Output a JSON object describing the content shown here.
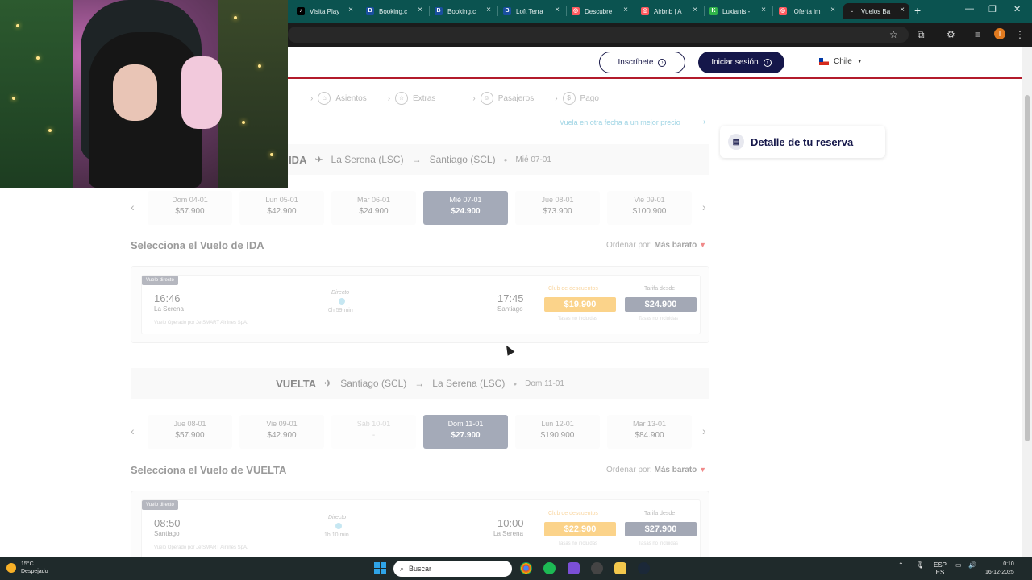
{
  "browser": {
    "tabs": [
      {
        "label": "Visita Play",
        "icon": "tiktok-icon",
        "color": "#000000",
        "glyph": "♪"
      },
      {
        "label": "Booking.c",
        "icon": "booking-icon",
        "color": "#1a4fa0",
        "glyph": "B"
      },
      {
        "label": "Booking.c",
        "icon": "booking-icon",
        "color": "#1a4fa0",
        "glyph": "B"
      },
      {
        "label": "Loft Terra",
        "icon": "booking-icon",
        "color": "#1a4fa0",
        "glyph": "B"
      },
      {
        "label": "Descubre",
        "icon": "airbnb-icon",
        "color": "#ff5a5f",
        "glyph": "◎"
      },
      {
        "label": "Airbnb | A",
        "icon": "airbnb-icon",
        "color": "#ff5a5f",
        "glyph": "◎"
      },
      {
        "label": "Luxianis -",
        "icon": "luxianis-icon",
        "color": "#30b34a",
        "glyph": "K"
      },
      {
        "label": "¡Oferta im",
        "icon": "airbnb-icon",
        "color": "#ff5a5f",
        "glyph": "◎"
      },
      {
        "label": "Vuelos Ba",
        "icon": "loading-icon",
        "color": "#1b1b1b",
        "glyph": "."
      }
    ],
    "profile_initial": "I"
  },
  "header": {
    "register_label": "Inscríbete",
    "login_label": "Iniciar sesión",
    "country": "Chile"
  },
  "steps": [
    {
      "label": "Asientos",
      "icon": "seat-icon",
      "glyph": "⌂"
    },
    {
      "label": "Extras",
      "icon": "star-icon",
      "glyph": "☆"
    },
    {
      "label": "Pasajeros",
      "icon": "passenger-icon",
      "glyph": "☺"
    },
    {
      "label": "Pago",
      "icon": "payment-icon",
      "glyph": "$"
    }
  ],
  "alt_date_link": "Vuela en otra fecha a un mejor precio",
  "reservation_detail": "Detalle de tu reserva",
  "outbound": {
    "direction": "IDA",
    "origin": "La Serena (LSC)",
    "destination": "Santiago (SCL)",
    "date": "Mié 07-01",
    "dates": [
      {
        "day": "Dom 04-01",
        "price": "$57.900"
      },
      {
        "day": "Lun 05-01",
        "price": "$42.900"
      },
      {
        "day": "Mar 06-01",
        "price": "$24.900"
      },
      {
        "day": "Mié 07-01",
        "price": "$24.900"
      },
      {
        "day": "Jue 08-01",
        "price": "$73.900"
      },
      {
        "day": "Vie 09-01",
        "price": "$100.900"
      }
    ],
    "section_title": "Selecciona el Vuelo de IDA",
    "sort_label": "Ordenar por:",
    "sort_value": "Más barato",
    "flight": {
      "badge": "Vuelo directo",
      "dep_time": "16:46",
      "dep_city": "La Serena",
      "arr_time": "17:45",
      "arr_city": "Santiago",
      "type": "Directo",
      "duration": "0h 59 min",
      "operator": "Vuelo Operado por JetSMART Airlines SpA.",
      "club_label": "Club de descuentos",
      "club_price": "$19.900",
      "fare_label": "Tarifa desde",
      "fare_price": "$24.900",
      "taxes_label": "Tasas no incluidas"
    }
  },
  "inbound": {
    "direction": "VUELTA",
    "origin": "Santiago (SCL)",
    "destination": "La Serena (LSC)",
    "date": "Dom 11-01",
    "dates": [
      {
        "day": "Jue 08-01",
        "price": "$57.900"
      },
      {
        "day": "Vie 09-01",
        "price": "$42.900"
      },
      {
        "day": "Sáb 10-01",
        "price": "-"
      },
      {
        "day": "Dom 11-01",
        "price": "$27.900"
      },
      {
        "day": "Lun 12-01",
        "price": "$190.900"
      },
      {
        "day": "Mar 13-01",
        "price": "$84.900"
      }
    ],
    "section_title": "Selecciona el Vuelo de VUELTA",
    "sort_label": "Ordenar por:",
    "sort_value": "Más barato",
    "flight": {
      "badge": "Vuelo directo",
      "dep_time": "08:50",
      "dep_city": "Santiago",
      "arr_time": "10:00",
      "arr_city": "La Serena",
      "type": "Directo",
      "duration": "1h 10 min",
      "operator": "Vuelo Operado por JetSMART Airlines SpA.",
      "club_label": "Club de descuentos",
      "club_price": "$22.900",
      "fare_label": "Tarifa desde",
      "fare_price": "$27.900",
      "taxes_label": "Tasas no incluidas"
    }
  },
  "taskbar": {
    "temperature": "15°C",
    "weather": "Despejado",
    "search_placeholder": "Buscar",
    "lang_top": "ESP",
    "lang_bottom": "ES",
    "time": "0:10",
    "date": "16-12-2025"
  }
}
